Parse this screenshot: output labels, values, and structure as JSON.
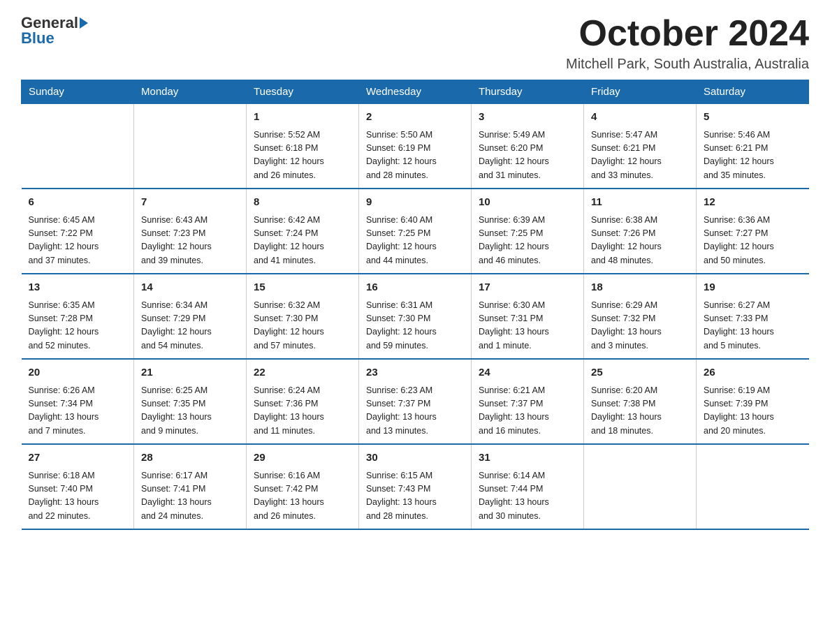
{
  "logo": {
    "general": "General",
    "blue": "Blue"
  },
  "title": "October 2024",
  "subtitle": "Mitchell Park, South Australia, Australia",
  "days_of_week": [
    "Sunday",
    "Monday",
    "Tuesday",
    "Wednesday",
    "Thursday",
    "Friday",
    "Saturday"
  ],
  "weeks": [
    [
      {
        "day": "",
        "info": ""
      },
      {
        "day": "",
        "info": ""
      },
      {
        "day": "1",
        "info": "Sunrise: 5:52 AM\nSunset: 6:18 PM\nDaylight: 12 hours\nand 26 minutes."
      },
      {
        "day": "2",
        "info": "Sunrise: 5:50 AM\nSunset: 6:19 PM\nDaylight: 12 hours\nand 28 minutes."
      },
      {
        "day": "3",
        "info": "Sunrise: 5:49 AM\nSunset: 6:20 PM\nDaylight: 12 hours\nand 31 minutes."
      },
      {
        "day": "4",
        "info": "Sunrise: 5:47 AM\nSunset: 6:21 PM\nDaylight: 12 hours\nand 33 minutes."
      },
      {
        "day": "5",
        "info": "Sunrise: 5:46 AM\nSunset: 6:21 PM\nDaylight: 12 hours\nand 35 minutes."
      }
    ],
    [
      {
        "day": "6",
        "info": "Sunrise: 6:45 AM\nSunset: 7:22 PM\nDaylight: 12 hours\nand 37 minutes."
      },
      {
        "day": "7",
        "info": "Sunrise: 6:43 AM\nSunset: 7:23 PM\nDaylight: 12 hours\nand 39 minutes."
      },
      {
        "day": "8",
        "info": "Sunrise: 6:42 AM\nSunset: 7:24 PM\nDaylight: 12 hours\nand 41 minutes."
      },
      {
        "day": "9",
        "info": "Sunrise: 6:40 AM\nSunset: 7:25 PM\nDaylight: 12 hours\nand 44 minutes."
      },
      {
        "day": "10",
        "info": "Sunrise: 6:39 AM\nSunset: 7:25 PM\nDaylight: 12 hours\nand 46 minutes."
      },
      {
        "day": "11",
        "info": "Sunrise: 6:38 AM\nSunset: 7:26 PM\nDaylight: 12 hours\nand 48 minutes."
      },
      {
        "day": "12",
        "info": "Sunrise: 6:36 AM\nSunset: 7:27 PM\nDaylight: 12 hours\nand 50 minutes."
      }
    ],
    [
      {
        "day": "13",
        "info": "Sunrise: 6:35 AM\nSunset: 7:28 PM\nDaylight: 12 hours\nand 52 minutes."
      },
      {
        "day": "14",
        "info": "Sunrise: 6:34 AM\nSunset: 7:29 PM\nDaylight: 12 hours\nand 54 minutes."
      },
      {
        "day": "15",
        "info": "Sunrise: 6:32 AM\nSunset: 7:30 PM\nDaylight: 12 hours\nand 57 minutes."
      },
      {
        "day": "16",
        "info": "Sunrise: 6:31 AM\nSunset: 7:30 PM\nDaylight: 12 hours\nand 59 minutes."
      },
      {
        "day": "17",
        "info": "Sunrise: 6:30 AM\nSunset: 7:31 PM\nDaylight: 13 hours\nand 1 minute."
      },
      {
        "day": "18",
        "info": "Sunrise: 6:29 AM\nSunset: 7:32 PM\nDaylight: 13 hours\nand 3 minutes."
      },
      {
        "day": "19",
        "info": "Sunrise: 6:27 AM\nSunset: 7:33 PM\nDaylight: 13 hours\nand 5 minutes."
      }
    ],
    [
      {
        "day": "20",
        "info": "Sunrise: 6:26 AM\nSunset: 7:34 PM\nDaylight: 13 hours\nand 7 minutes."
      },
      {
        "day": "21",
        "info": "Sunrise: 6:25 AM\nSunset: 7:35 PM\nDaylight: 13 hours\nand 9 minutes."
      },
      {
        "day": "22",
        "info": "Sunrise: 6:24 AM\nSunset: 7:36 PM\nDaylight: 13 hours\nand 11 minutes."
      },
      {
        "day": "23",
        "info": "Sunrise: 6:23 AM\nSunset: 7:37 PM\nDaylight: 13 hours\nand 13 minutes."
      },
      {
        "day": "24",
        "info": "Sunrise: 6:21 AM\nSunset: 7:37 PM\nDaylight: 13 hours\nand 16 minutes."
      },
      {
        "day": "25",
        "info": "Sunrise: 6:20 AM\nSunset: 7:38 PM\nDaylight: 13 hours\nand 18 minutes."
      },
      {
        "day": "26",
        "info": "Sunrise: 6:19 AM\nSunset: 7:39 PM\nDaylight: 13 hours\nand 20 minutes."
      }
    ],
    [
      {
        "day": "27",
        "info": "Sunrise: 6:18 AM\nSunset: 7:40 PM\nDaylight: 13 hours\nand 22 minutes."
      },
      {
        "day": "28",
        "info": "Sunrise: 6:17 AM\nSunset: 7:41 PM\nDaylight: 13 hours\nand 24 minutes."
      },
      {
        "day": "29",
        "info": "Sunrise: 6:16 AM\nSunset: 7:42 PM\nDaylight: 13 hours\nand 26 minutes."
      },
      {
        "day": "30",
        "info": "Sunrise: 6:15 AM\nSunset: 7:43 PM\nDaylight: 13 hours\nand 28 minutes."
      },
      {
        "day": "31",
        "info": "Sunrise: 6:14 AM\nSunset: 7:44 PM\nDaylight: 13 hours\nand 30 minutes."
      },
      {
        "day": "",
        "info": ""
      },
      {
        "day": "",
        "info": ""
      }
    ]
  ]
}
